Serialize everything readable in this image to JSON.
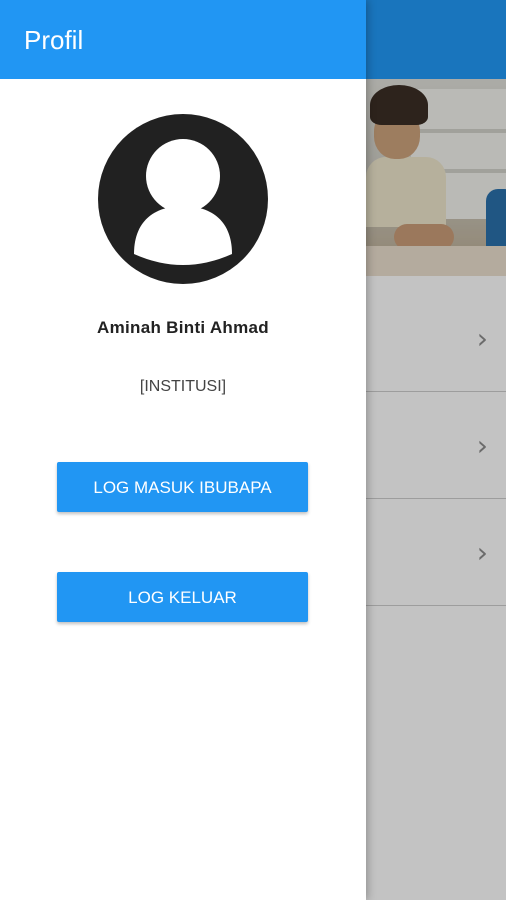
{
  "drawer": {
    "title": "Profil",
    "user_name": "Aminah Binti Ahmad",
    "institution": "[INSTITUSI]",
    "parent_login_label": "LOG MASUK IBUBAPA",
    "logout_label": "LOG KELUAR"
  },
  "background": {
    "list_rows": [
      {
        "chevron": "›"
      },
      {
        "chevron": "›"
      },
      {
        "chevron": "›"
      }
    ]
  },
  "colors": {
    "primary": "#2196f3",
    "avatar": "#212121"
  },
  "icons": {
    "avatar": "account-circle-icon",
    "chevron": "chevron-right-icon"
  }
}
